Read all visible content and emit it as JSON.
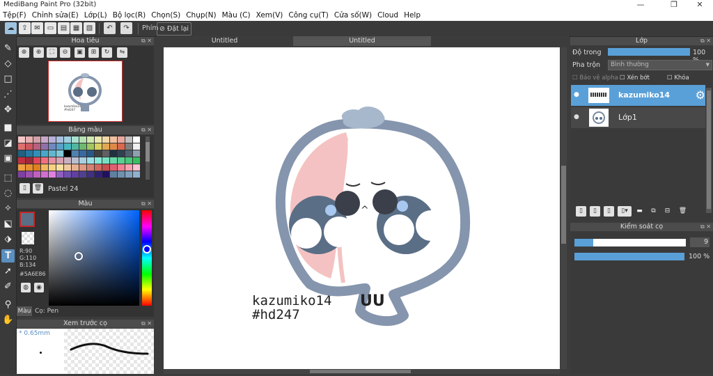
{
  "window": {
    "title": "MediBang Paint Pro (32bit)",
    "minimize": "—",
    "restore": "❐",
    "close": "✕"
  },
  "menu": [
    "Tệp(F)",
    "Chỉnh sửa(E)",
    "Lớp(L)",
    "Bộ lọc(R)",
    "Chọn(S)",
    "Chụp(N)",
    "Màu (C)",
    "Xem(V)",
    "Công cụ(T)",
    "Cửa số(W)",
    "Cloud",
    "Help"
  ],
  "toolbar": {
    "shortcut_label": "Phím",
    "reset_label": "Đặt lại"
  },
  "navigator": {
    "title": "Hoa tiêu",
    "sketch_caption": "kazumiko14 #hd247"
  },
  "palette": {
    "title": "Bảng màu",
    "name": "Pastel 24"
  },
  "color_panel": {
    "title": "Màu",
    "r": "R:90",
    "g": "G:110",
    "b": "B:134",
    "hex": "#5A6E86",
    "tab_color": "Màu",
    "tab_brush": "Cọ: Pen",
    "current": "#5A6E86"
  },
  "brush_preview": {
    "title": "Xem trước cọ",
    "size": "0.65mm"
  },
  "tabs": [
    "Untitled",
    "Untitled"
  ],
  "canvas": {
    "text_line1": "kazumiko14",
    "text_line2": "#hd247",
    "sleep_mark": "^",
    "mouth": "UU"
  },
  "layers_panel": {
    "title": "Lớp",
    "opacity_label": "Độ trong",
    "opacity_value": "100 %",
    "opacity_fraction": 1.0,
    "blend_label": "Pha trộn",
    "blend_value": "Bình thường",
    "protect_alpha": "Bảo vệ alpha",
    "clipping": "Xén bớt",
    "lock": "Khóa",
    "layers": [
      {
        "name": "kazumiko14",
        "selected": true
      },
      {
        "name": "Lớp1",
        "selected": false
      }
    ]
  },
  "brush_control": {
    "title": "Kiểm soát cọ",
    "size_value": "9",
    "size_fraction": 0.17,
    "opacity_value": "100 %",
    "opacity_fraction": 1.0
  },
  "palette_colors": [
    "#f4c6c6",
    "#e8b0b0",
    "#d4a0a8",
    "#c8a8c8",
    "#b8b0d8",
    "#a8c0e0",
    "#a0d0e0",
    "#a8e0d0",
    "#b8e0b0",
    "#d0e8b0",
    "#e8e8b0",
    "#f0d8a8",
    "#f0c0a0",
    "#e8a8a0",
    "#c0c0c0",
    "#ffffff",
    "#e07070",
    "#d05860",
    "#b86080",
    "#9070a8",
    "#7088c0",
    "#5aa0c8",
    "#48b8c0",
    "#50b8a0",
    "#70b870",
    "#a0c860",
    "#d8d060",
    "#e0a850",
    "#e08848",
    "#d86850",
    "#808080",
    "#f0f0f0",
    "#206080",
    "#2878a0",
    "#3090b8",
    "#4aa8c8",
    "#60b8d0",
    "#80c8d8",
    "#000000",
    "#5080b0",
    "#3868a0",
    "#285888",
    "#404040",
    "#606060",
    "#203040",
    "#304050",
    "#506070",
    "#90a0b0",
    "#c03040",
    "#a02838",
    "#e04858",
    "#f07080",
    "#e890a0",
    "#d8a0b0",
    "#c8b0c0",
    "#b8c0d0",
    "#a8d0e0",
    "#98e0e8",
    "#88e8d8",
    "#78e0c0",
    "#68d8a8",
    "#58d090",
    "#48c878",
    "#38c060",
    "#f0a040",
    "#e89030",
    "#e08020",
    "#f0b860",
    "#f8d080",
    "#f8e0a0",
    "#f0c8a0",
    "#e8b090",
    "#e09880",
    "#d88070",
    "#d06860",
    "#c85050",
    "#e06070",
    "#f08090",
    "#f8a0b0",
    "#ffc0d0",
    "#8040a0",
    "#a050b0",
    "#c060c0",
    "#d070d0",
    "#e080e0",
    "#9060c0",
    "#7050b0",
    "#6040a0",
    "#504090",
    "#403080",
    "#302070",
    "#201060",
    "#6080a0",
    "#7090b0",
    "#80a0c0",
    "#90b0d0"
  ]
}
